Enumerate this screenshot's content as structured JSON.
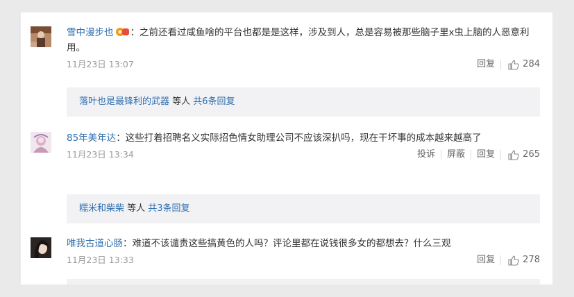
{
  "comments": [
    {
      "username": "雪中漫步也",
      "text": "：之前还看过咸鱼啥的平台也都是是这样，涉及到人，总是容易被那些脑子里x虫上脑的人恶意利用。",
      "time": "11月23日 13:07",
      "actions": [
        "回复"
      ],
      "likes": "284",
      "replies": {
        "user": "落叶也是最锋利的武器",
        "middle": " 等人 ",
        "link": "共6条回复"
      }
    },
    {
      "username": "85年美年达",
      "text": "：这些打着招聘名义实际招色情女助理公司不应该深扒吗，现在干坏事的成本越来越高了",
      "time": "11月23日 13:34",
      "actions": [
        "投诉",
        "屏蔽",
        "回复"
      ],
      "likes": "265",
      "replies": {
        "user": "糯米和柴柴",
        "middle": " 等人 ",
        "link": "共3条回复"
      }
    },
    {
      "username": "唯我古道心肠",
      "text": "：难道不该谴责这些搞黄色的人吗？评论里都在说钱很多女的都想去？什么三观",
      "time": "11月23日 13:33",
      "actions": [
        "回复"
      ],
      "likes": "278"
    }
  ],
  "colors": {
    "username": "#2f6fb0",
    "vip_name": "#eb7350",
    "subbox_bg": "#f2f2f5"
  }
}
